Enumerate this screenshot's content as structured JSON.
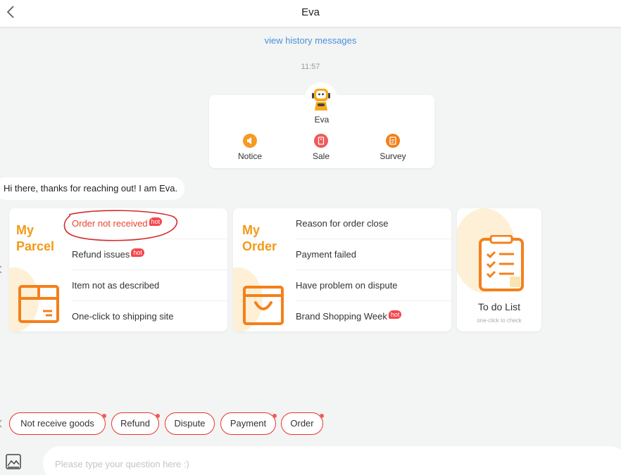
{
  "header": {
    "title": "Eva"
  },
  "history_link": "view history messages",
  "timestamp": "11:57",
  "profile": {
    "name": "Eva",
    "actions": [
      {
        "label": "Notice",
        "icon": "megaphone-icon",
        "color": "#f59a22"
      },
      {
        "label": "Sale",
        "icon": "sale-tag-icon",
        "color": "#f05a5a"
      },
      {
        "label": "Survey",
        "icon": "survey-icon",
        "color": "#f3801b"
      }
    ]
  },
  "greeting": "Hi there, thanks for reaching out! I am Eva.",
  "parcel_card": {
    "title_line1": "My",
    "title_line2": "Parcel",
    "items": [
      {
        "label": "Order not received",
        "hot": "hot"
      },
      {
        "label": "Refund issues",
        "hot": "hot"
      },
      {
        "label": "Item not as described"
      },
      {
        "label": "One-click to shipping site"
      }
    ]
  },
  "order_card": {
    "title_line1": "My",
    "title_line2": "Order",
    "items": [
      {
        "label": "Reason for order close"
      },
      {
        "label": "Payment failed"
      },
      {
        "label": "Have problem on dispute"
      },
      {
        "label": "Brand Shopping Week",
        "hot": "hot"
      }
    ]
  },
  "todo_card": {
    "title": "To do List",
    "subtitle": "one-click to check"
  },
  "quick_replies": [
    "Not receive goods",
    "Refund",
    "Dispute",
    "Payment",
    "Order"
  ],
  "input": {
    "placeholder": "Please type your question here :)"
  },
  "colors": {
    "accent": "#f39a19",
    "hot": "#f5464c",
    "link": "#4a90d9",
    "quick_border": "#e9342c"
  }
}
